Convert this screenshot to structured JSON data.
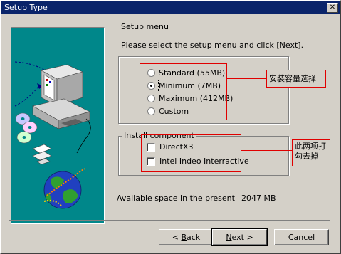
{
  "window": {
    "title": "Setup Type",
    "close_glyph": "✕"
  },
  "heading": "Setup menu",
  "instruction": "Please select the setup menu and click [Next].",
  "setup_options": [
    {
      "label": "Standard (55MB)",
      "selected": false
    },
    {
      "label": "Minimum (7MB)",
      "selected": true
    },
    {
      "label": "Maximum (412MB)",
      "selected": false
    },
    {
      "label": "Custom",
      "selected": false
    }
  ],
  "install_component": {
    "title": "Install component",
    "items": [
      {
        "label": "DirectX3",
        "checked": false
      },
      {
        "label": "Intel Indeo Interractive",
        "checked": false
      }
    ]
  },
  "annotations": {
    "capacity_note": "安装容量选择",
    "uncheck_note_line1": "此两项打",
    "uncheck_note_line2": "勾去掉"
  },
  "space": {
    "label": "Available space in the present",
    "value": "2047 MB"
  },
  "buttons": {
    "back_prefix": "< ",
    "back_mnemonic": "B",
    "back_rest": "ack",
    "next_mnemonic": "N",
    "next_rest": "ext >",
    "cancel": "Cancel"
  },
  "banner_icons": [
    "computer-icon",
    "compact-disc-icon",
    "floppy-disk-icon",
    "globe-icon"
  ],
  "colors": {
    "titlebar": "#0a246a",
    "banner": "#00878a",
    "annotation": "#e00000",
    "face": "#d4d0c8"
  }
}
